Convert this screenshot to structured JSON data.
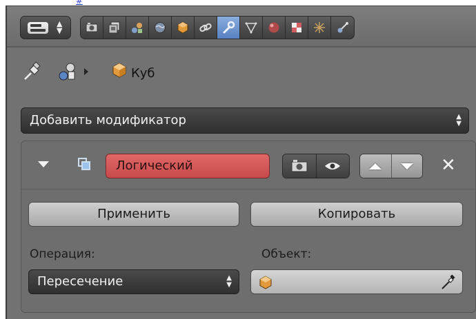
{
  "top_link": "#",
  "header": {
    "editor_type_icon": "properties-editor-icon",
    "tabs": [
      {
        "icon": "render-icon"
      },
      {
        "icon": "render-layers-icon"
      },
      {
        "icon": "scene-icon"
      },
      {
        "icon": "world-icon"
      },
      {
        "icon": "object-icon"
      },
      {
        "icon": "constraints-icon"
      },
      {
        "icon": "modifiers-wrench-icon",
        "active": true
      },
      {
        "icon": "object-data-icon"
      },
      {
        "icon": "material-icon"
      },
      {
        "icon": "texture-icon"
      },
      {
        "icon": "particles-icon"
      },
      {
        "icon": "physics-icon"
      }
    ]
  },
  "breadcrumb": {
    "object_name": "Куб"
  },
  "add_modifier": {
    "label": "Добавить модификатор"
  },
  "modifier": {
    "name": "Логический",
    "apply_label": "Применить",
    "copy_label": "Копировать",
    "operation_label": "Операция:",
    "operation_value": "Пересечение",
    "object_label": "Объект:",
    "object_value": ""
  },
  "colors": {
    "panel_bg": "#727272",
    "modifier_name_bg": "#d95a5a",
    "active_tab": "#6f94d0"
  }
}
